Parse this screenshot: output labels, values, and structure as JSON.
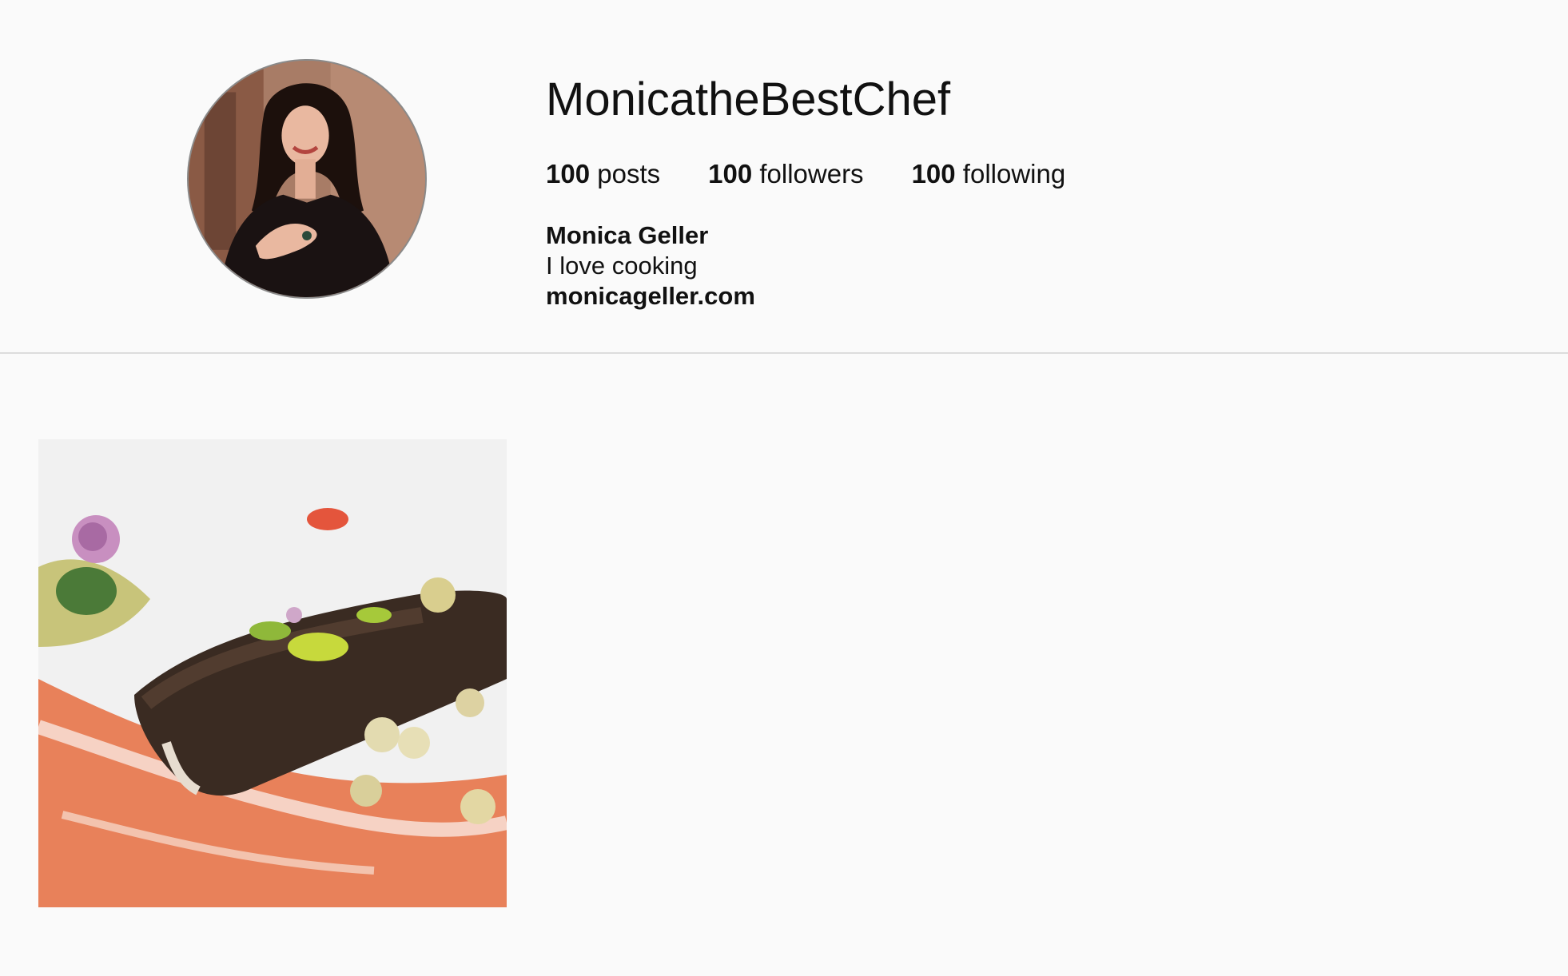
{
  "profile": {
    "username": "MonicatheBestChef",
    "stats": {
      "posts_count": "100",
      "posts_label": "posts",
      "followers_count": "100",
      "followers_label": "followers",
      "following_count": "100",
      "following_label": "following"
    },
    "bio": {
      "full_name": "Monica Geller",
      "description": "I love cooking",
      "website": "monicageller.com"
    }
  },
  "posts": [
    {
      "alt": ""
    }
  ],
  "colors": {
    "background": "#fafafa",
    "divider": "#dcdcdc",
    "text": "#111111"
  }
}
